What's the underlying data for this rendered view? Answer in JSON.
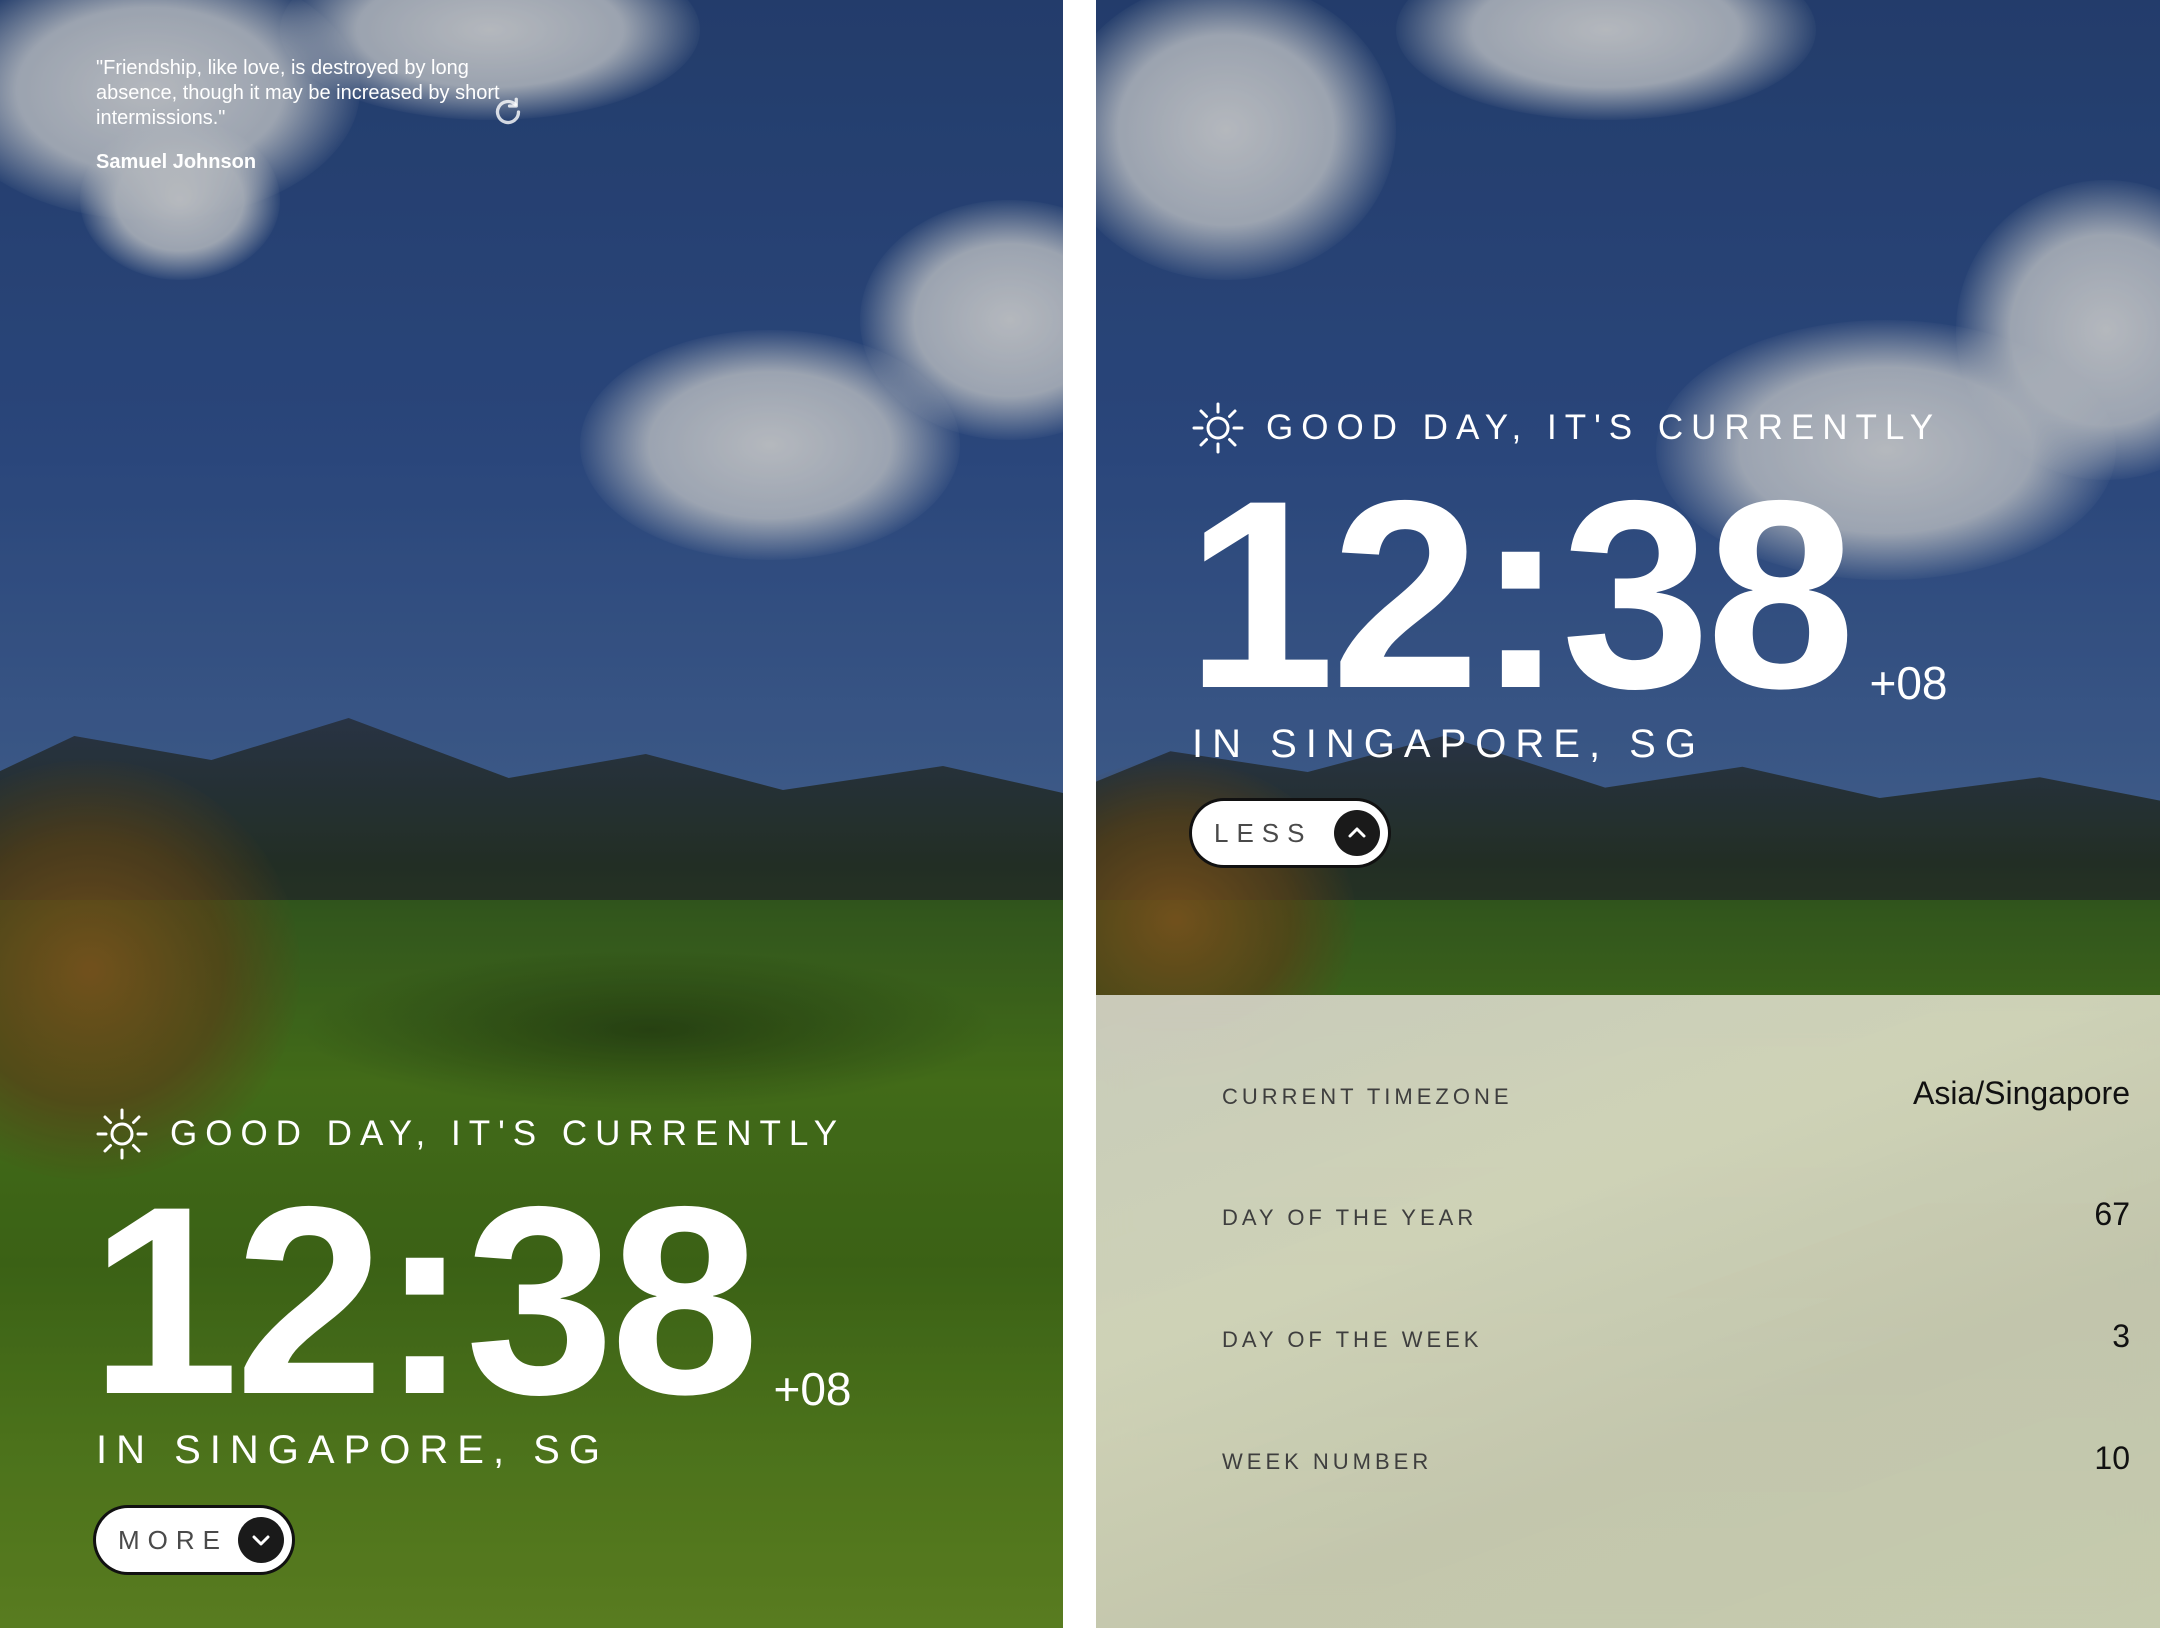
{
  "left_screen": {
    "quote": {
      "text": "\"Friendship, like love, is destroyed by long absence, though it may be increased by short intermissions.\"",
      "author": "Samuel Johnson"
    },
    "greeting": "GOOD DAY, IT'S CURRENTLY",
    "time": "12:38",
    "utc_offset": "+08",
    "location": "IN SINGAPORE, SG",
    "toggle_label": "MORE",
    "toggle_icon": "chevron-down-icon"
  },
  "right_screen": {
    "greeting": "GOOD DAY, IT'S CURRENTLY",
    "time": "12:38",
    "utc_offset": "+08",
    "location": "IN SINGAPORE, SG",
    "toggle_label": "LESS",
    "toggle_icon": "chevron-up-icon",
    "details": [
      {
        "label": "CURRENT TIMEZONE",
        "value": "Asia/Singapore"
      },
      {
        "label": "DAY OF THE YEAR",
        "value": "67"
      },
      {
        "label": "DAY OF THE WEEK",
        "value": "3"
      },
      {
        "label": "WEEK NUMBER",
        "value": "10"
      }
    ]
  },
  "colors": {
    "text_light": "#ffffff",
    "button_bg": "#ffffff",
    "button_arrow_bg": "#1a1a1a",
    "panel_text_dark": "#111111"
  }
}
